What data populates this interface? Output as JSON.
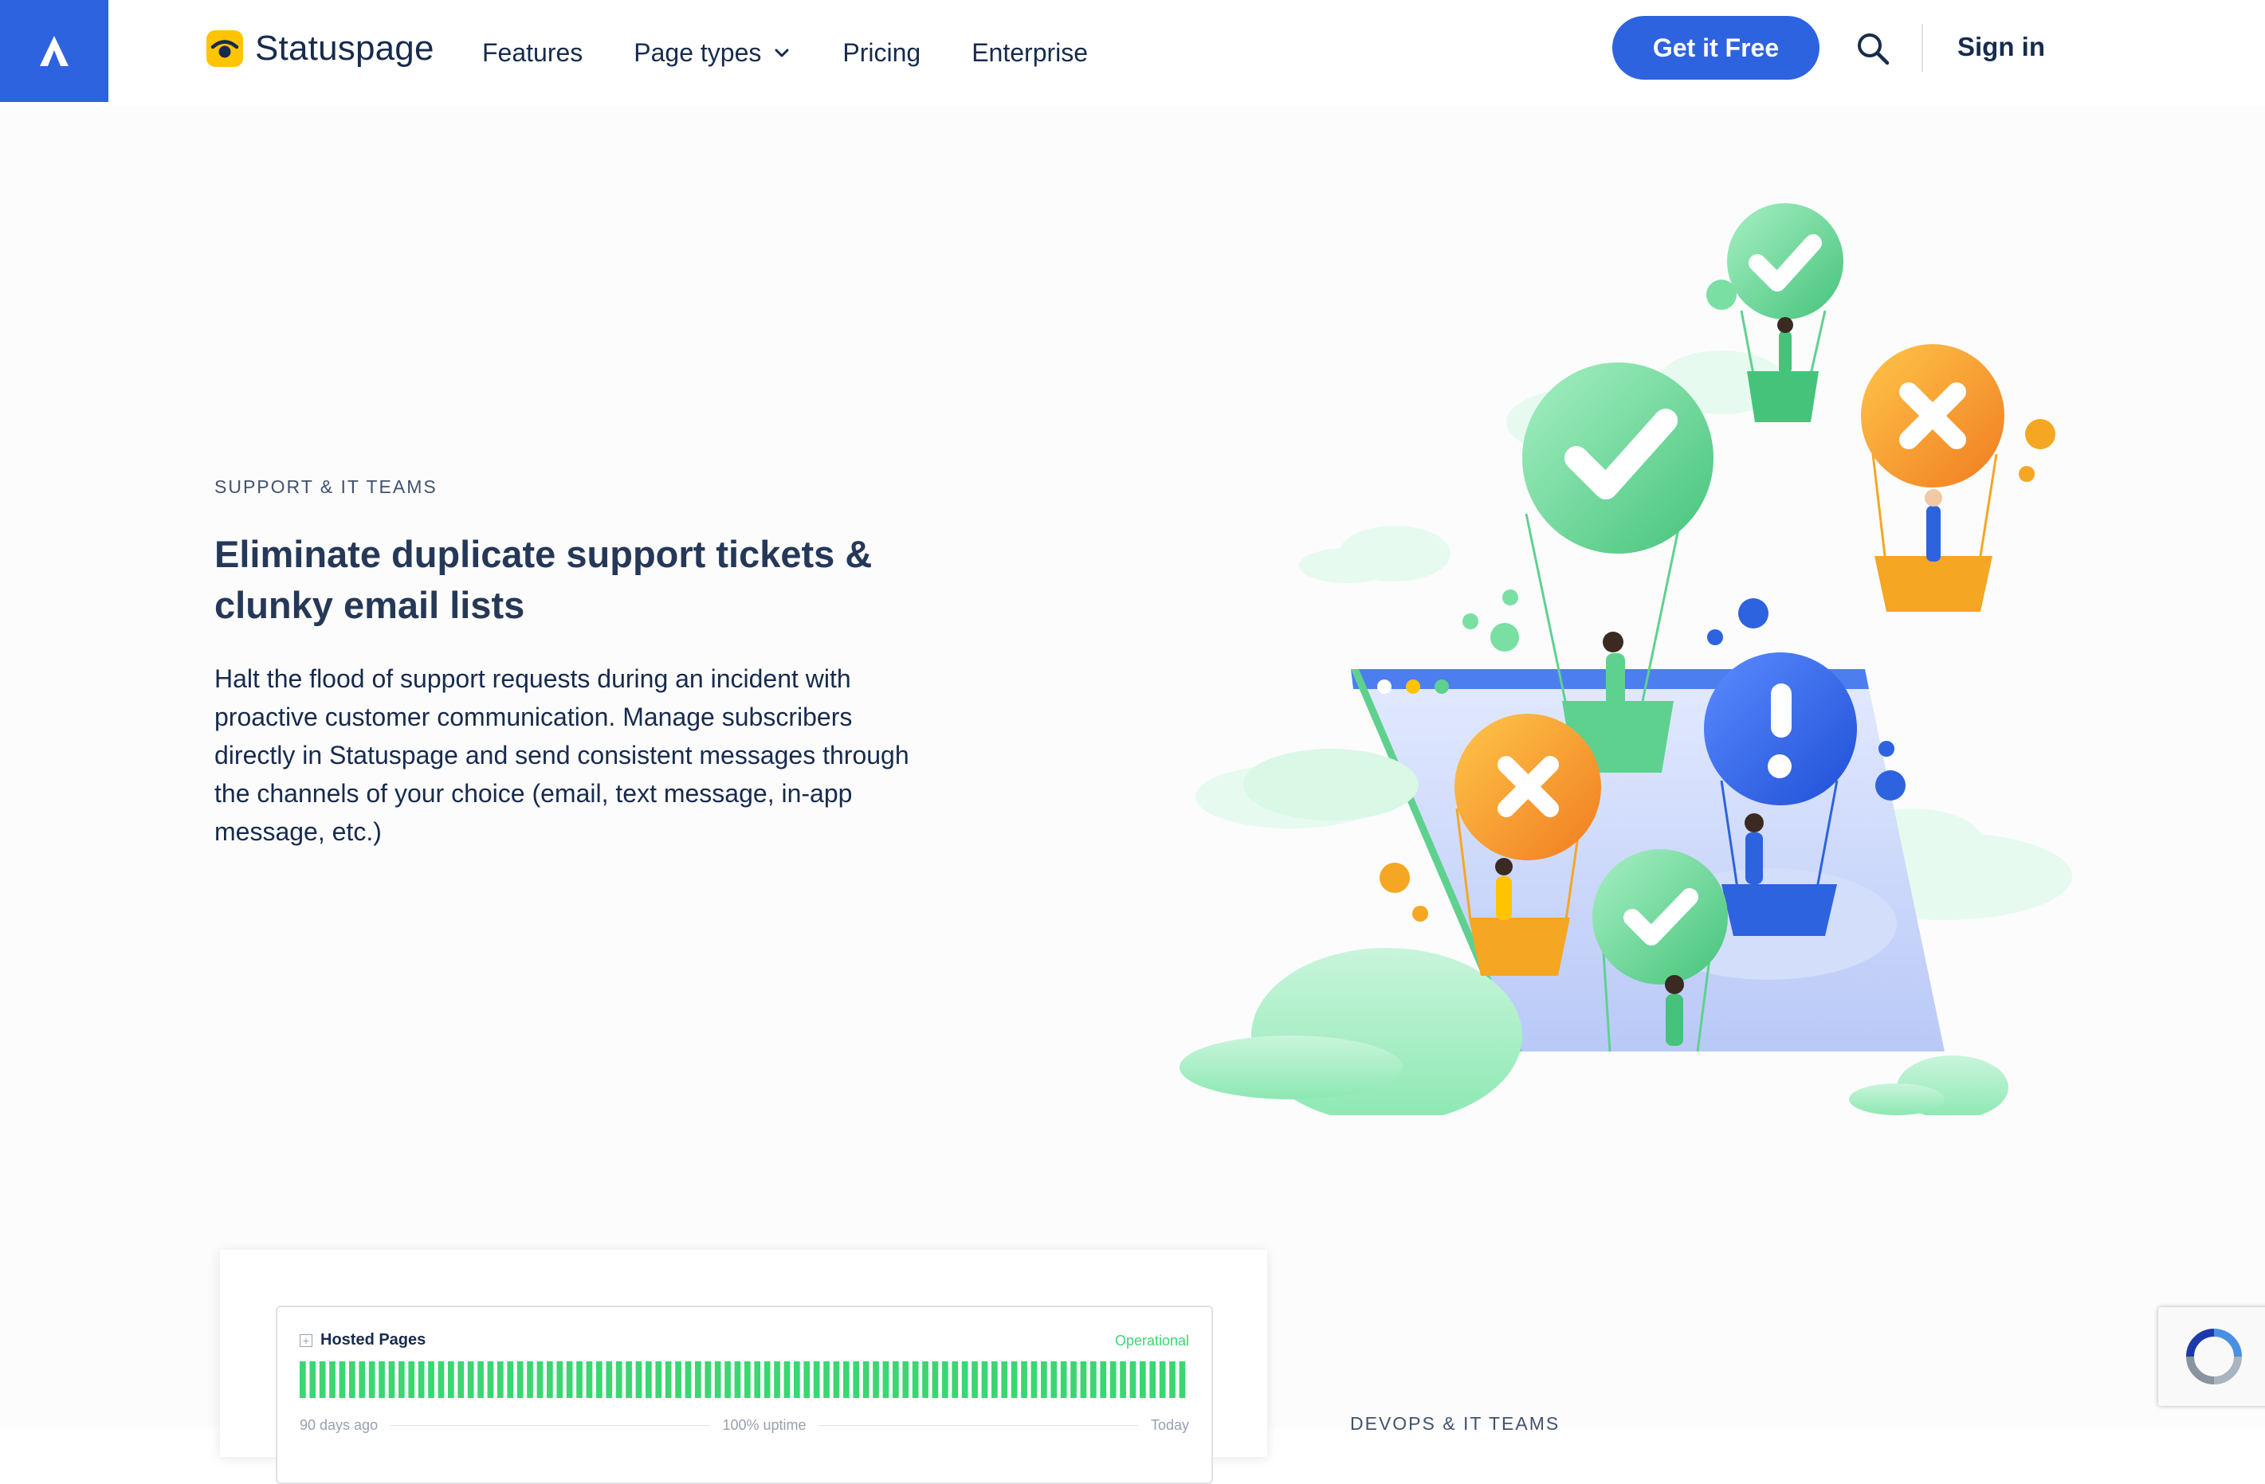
{
  "nav": {
    "brand": "Statuspage",
    "links": [
      {
        "label": "Features"
      },
      {
        "label": "Page types"
      },
      {
        "label": "Pricing"
      },
      {
        "label": "Enterprise"
      }
    ],
    "cta": "Get it Free",
    "sign_in": "Sign in"
  },
  "hero": {
    "eyebrow": "SUPPORT & IT TEAMS",
    "title": "Eliminate duplicate support tickets & clunky email lists",
    "body": "Halt the flood of support requests during an incident with proactive customer communication. Manage subscribers directly in Statuspage and send consistent messages through the channels of your choice (email, text message, in-app message, etc.)"
  },
  "widget": {
    "component": "Hosted Pages",
    "status": "Operational",
    "footer_left": "90 days ago",
    "footer_mid": "100% uptime",
    "footer_right": "Today",
    "bar_count": 90,
    "uptime_percent": 100
  },
  "next_section": {
    "eyebrow": "DEVOPS & IT TEAMS"
  },
  "colors": {
    "brand_blue": "#2d63de",
    "text_dark": "#172b4d",
    "uptime_green": "#3bd671",
    "logo_yellow": "#ffc400"
  },
  "icons": {
    "atlassian": "atlassian-logo-icon",
    "statuspage": "statuspage-logo-icon",
    "dropdown": "chevron-down-icon",
    "search": "search-icon",
    "recaptcha": "recaptcha-icon"
  }
}
